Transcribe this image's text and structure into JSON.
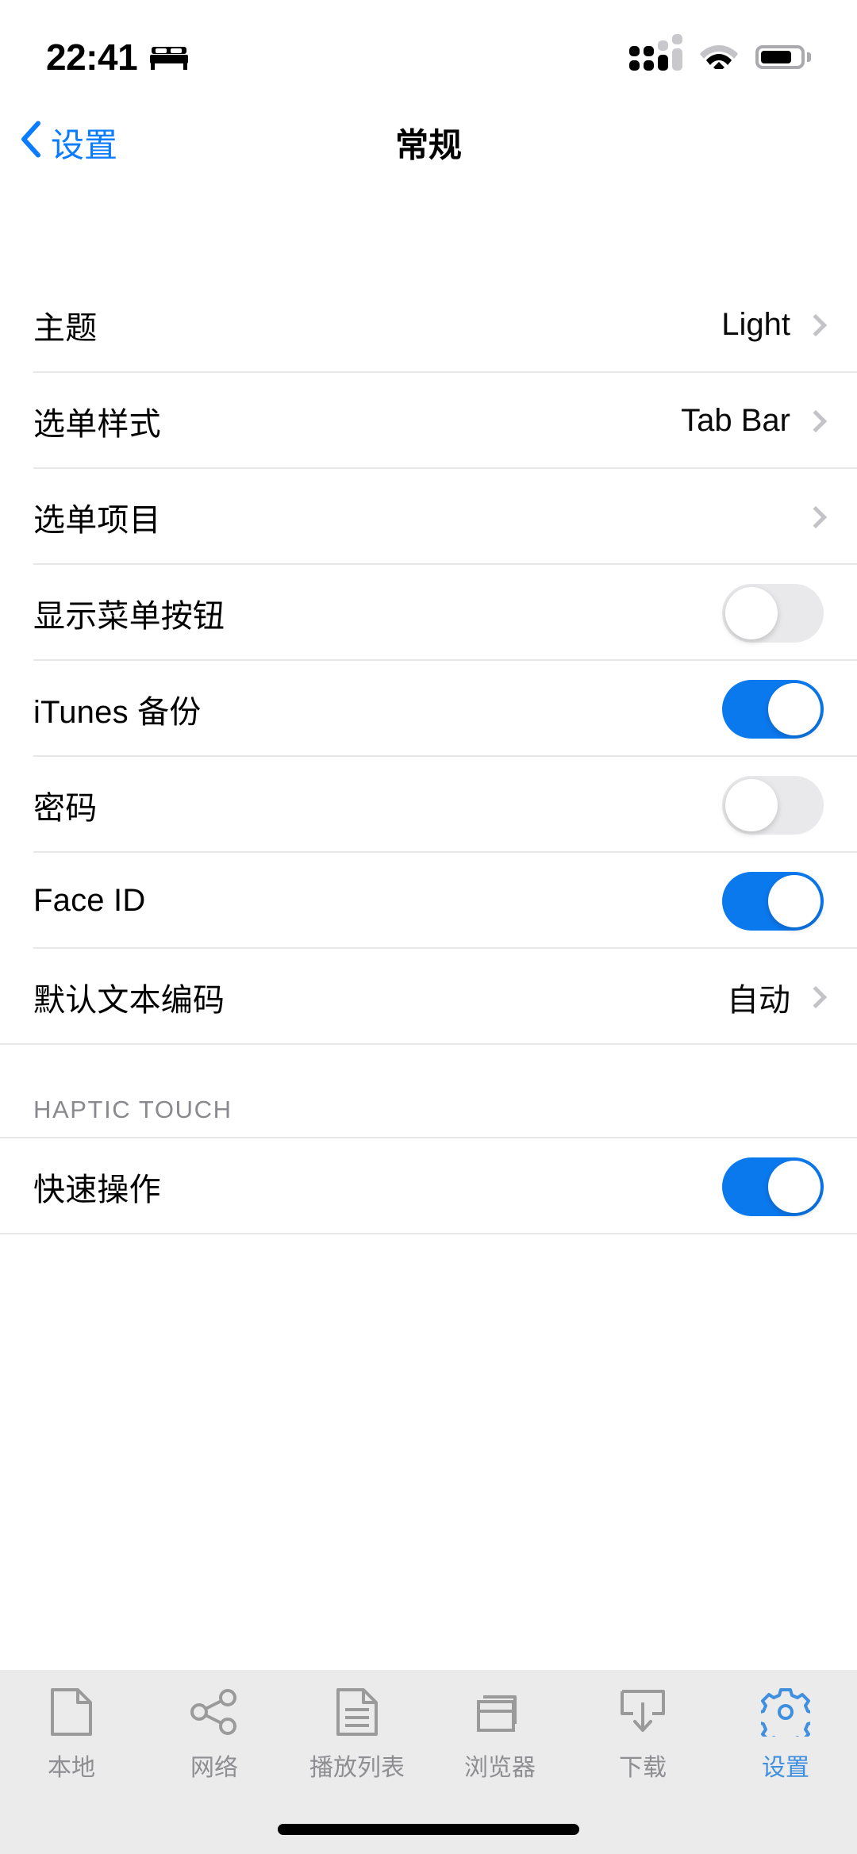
{
  "status_bar": {
    "time": "22:41",
    "focus_icon": "bed-icon",
    "signal_icon": "cellular-signal-icon",
    "wifi_icon": "wifi-icon",
    "battery_icon": "battery-icon",
    "battery_level_percent": 80
  },
  "nav": {
    "back_label": "设置",
    "title": "常规",
    "back_icon": "chevron-left-icon",
    "accent_color": "#0a7cff"
  },
  "settings": {
    "rows": [
      {
        "label": "主题",
        "value": "Light",
        "type": "disclosure"
      },
      {
        "label": "选单样式",
        "value": "Tab Bar",
        "type": "disclosure"
      },
      {
        "label": "选单项目",
        "value": "",
        "type": "disclosure"
      },
      {
        "label": "显示菜单按钮",
        "value": "",
        "type": "toggle",
        "on": false
      },
      {
        "label": "iTunes 备份",
        "value": "",
        "type": "toggle",
        "on": true
      },
      {
        "label": "密码",
        "value": "",
        "type": "toggle",
        "on": false
      },
      {
        "label": "Face ID",
        "value": "",
        "type": "toggle",
        "on": true
      },
      {
        "label": "默认文本编码",
        "value": "自动",
        "type": "disclosure"
      }
    ]
  },
  "haptic_section": {
    "header": "HAPTIC TOUCH",
    "rows": [
      {
        "label": "快速操作",
        "value": "",
        "type": "toggle",
        "on": true
      }
    ]
  },
  "tabbar": {
    "items": [
      {
        "label": "本地",
        "icon": "document-icon",
        "active": false
      },
      {
        "label": "网络",
        "icon": "share-network-icon",
        "active": false
      },
      {
        "label": "播放列表",
        "icon": "document-lines-icon",
        "active": false
      },
      {
        "label": "浏览器",
        "icon": "browser-windows-icon",
        "active": false
      },
      {
        "label": "下载",
        "icon": "download-icon",
        "active": false
      },
      {
        "label": "设置",
        "icon": "gear-icon",
        "active": true
      }
    ],
    "active_color": "#3e8fe0",
    "inactive_color": "#8e8e93"
  },
  "colors": {
    "toggle_on": "#0b79ee",
    "toggle_off": "#e9e9eb",
    "separator": "#e8e8ea",
    "tabbar_bg": "#ebebeb"
  }
}
